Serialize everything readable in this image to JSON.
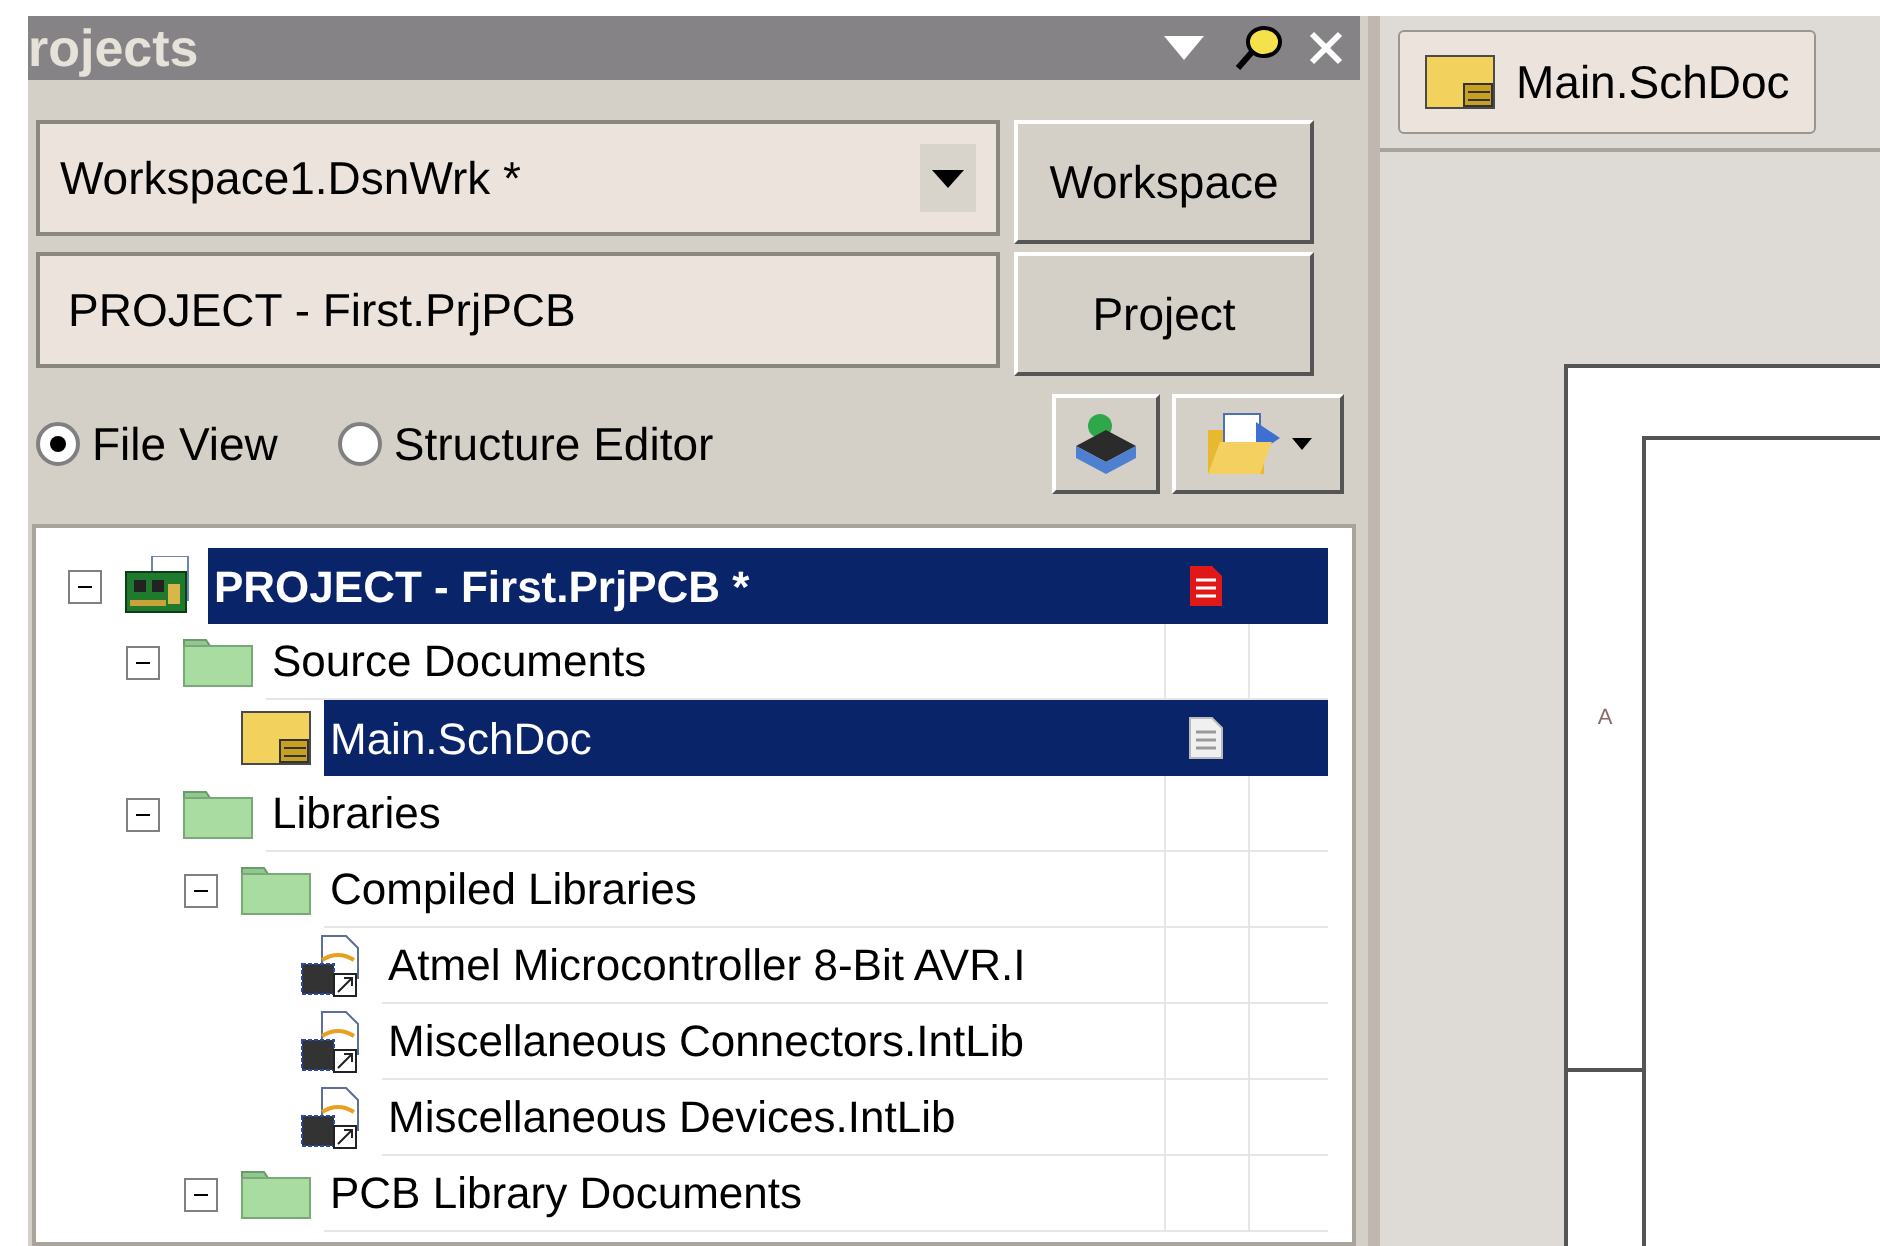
{
  "panel": {
    "title": "rojects"
  },
  "workspace_select": {
    "value": "Workspace1.DsnWrk *"
  },
  "workspace_button": "Workspace",
  "project_field": {
    "value": "PROJECT - First.PrjPCB"
  },
  "project_button": "Project",
  "view_options": [
    {
      "label": "File View",
      "selected": true
    },
    {
      "label": "Structure Editor",
      "selected": false
    }
  ],
  "tree": [
    {
      "kind": "project",
      "label": "PROJECT - First.PrjPCB  *",
      "selected": true,
      "expanded": true,
      "modified": true,
      "children": [
        {
          "kind": "folder",
          "label": "Source Documents",
          "selected": false,
          "expanded": true,
          "children": [
            {
              "kind": "schematic",
              "label": "Main.SchDoc",
              "selected": true,
              "modified": false
            }
          ]
        },
        {
          "kind": "folder",
          "label": "Libraries",
          "selected": false,
          "expanded": true,
          "children": [
            {
              "kind": "folder",
              "label": "Compiled Libraries",
              "selected": false,
              "expanded": true,
              "children": [
                {
                  "kind": "library",
                  "label": "Atmel Microcontroller 8-Bit AVR.I",
                  "selected": false
                },
                {
                  "kind": "library",
                  "label": "Miscellaneous Connectors.IntLib",
                  "selected": false
                },
                {
                  "kind": "library",
                  "label": "Miscellaneous Devices.IntLib",
                  "selected": false
                }
              ]
            },
            {
              "kind": "folder",
              "label": "PCB Library Documents",
              "selected": false,
              "expanded": true
            }
          ]
        }
      ]
    }
  ],
  "document_tabs": [
    {
      "label": "Main.SchDoc",
      "selected": true
    }
  ],
  "sheet": {
    "zone_label": "A"
  }
}
